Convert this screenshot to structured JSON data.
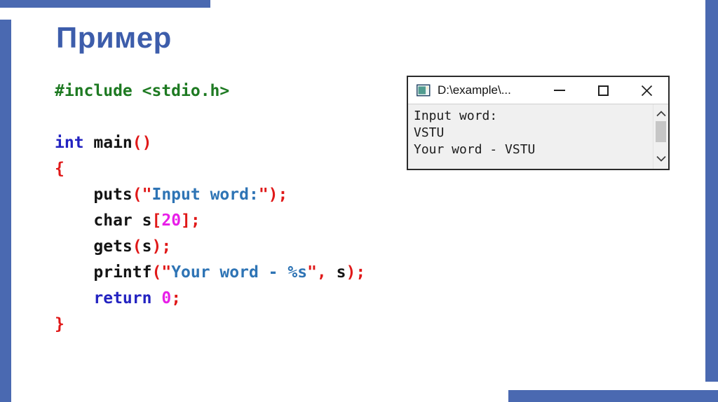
{
  "slide": {
    "title": "Пример"
  },
  "colors": {
    "accent": "#4a69b1",
    "title_text": "#3d5dab",
    "green": "#1e7a22",
    "keyword": "#2323c1",
    "string": "#2e74b5",
    "red": "#e01919",
    "number": "#e81ee8",
    "plain": "#141414"
  },
  "code": {
    "lines": [
      [
        {
          "c": "green",
          "t": "#include <stdio.h>"
        }
      ],
      [],
      [
        {
          "c": "kw",
          "t": "int"
        },
        {
          "c": "plain",
          "t": " main"
        },
        {
          "c": "red",
          "t": "()"
        }
      ],
      [
        {
          "c": "red",
          "t": "{"
        }
      ],
      [
        {
          "c": "plain",
          "t": "    puts"
        },
        {
          "c": "red",
          "t": "(\""
        },
        {
          "c": "str",
          "t": "Input word:"
        },
        {
          "c": "red",
          "t": "\");"
        }
      ],
      [
        {
          "c": "plain",
          "t": "    char s"
        },
        {
          "c": "red",
          "t": "["
        },
        {
          "c": "num",
          "t": "20"
        },
        {
          "c": "red",
          "t": "];"
        }
      ],
      [
        {
          "c": "plain",
          "t": "    gets"
        },
        {
          "c": "red",
          "t": "("
        },
        {
          "c": "plain",
          "t": "s"
        },
        {
          "c": "red",
          "t": ");"
        }
      ],
      [
        {
          "c": "plain",
          "t": "    printf"
        },
        {
          "c": "red",
          "t": "(\""
        },
        {
          "c": "str",
          "t": "Your word - %s"
        },
        {
          "c": "red",
          "t": "\","
        },
        {
          "c": "plain",
          "t": " s"
        },
        {
          "c": "red",
          "t": ");"
        }
      ],
      [
        {
          "c": "kw",
          "t": "    return"
        },
        {
          "c": "plain",
          "t": " "
        },
        {
          "c": "num",
          "t": "0"
        },
        {
          "c": "red",
          "t": ";"
        }
      ],
      [
        {
          "c": "red",
          "t": "}"
        }
      ]
    ]
  },
  "console": {
    "title": "D:\\example\\...",
    "output_lines": [
      "Input word:",
      "VSTU",
      "Your word - VSTU"
    ],
    "icons": {
      "console_icon": "console-window",
      "minimize_icon": "–",
      "maximize_icon": "□",
      "close_icon": "✕",
      "scroll_up_icon": "⌃",
      "scroll_down_icon": "⌄"
    }
  }
}
